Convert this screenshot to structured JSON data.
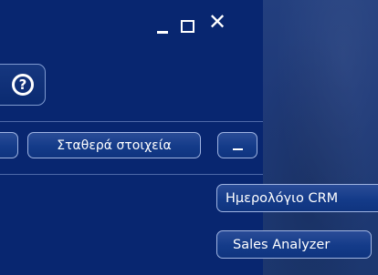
{
  "window_controls": {
    "minimize_icon": "minimize-icon",
    "maximize_icon": "maximize-icon",
    "close_icon": "close-icon",
    "close_glyph": "✕"
  },
  "toolbar": {
    "help_icon": "help-icon",
    "help_glyph": "?",
    "fixed_data_label": "Σταθερά στοιχεία",
    "collapse_icon": "minus-icon"
  },
  "menu": {
    "items": [
      {
        "label": "Ημερολόγιο CRM"
      },
      {
        "label": "Sales Analyzer"
      }
    ]
  },
  "colors": {
    "panel_bg": "#082670",
    "button_border": "#9fb4e2",
    "text": "#ffffff"
  }
}
